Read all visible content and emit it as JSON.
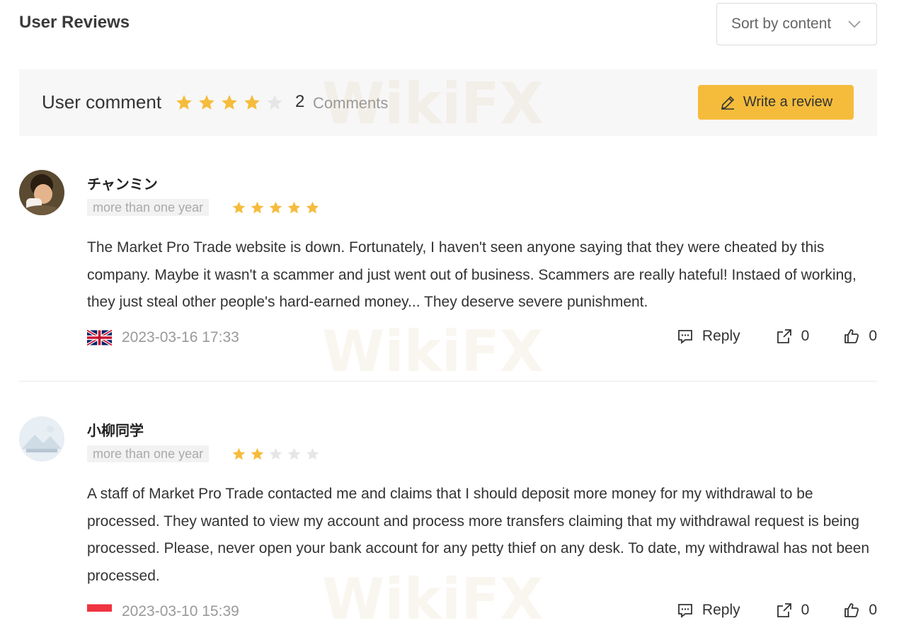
{
  "header": {
    "title": "User Reviews",
    "sort_label": "Sort by content"
  },
  "summary": {
    "label": "User comment",
    "rating": 4,
    "max_rating": 5,
    "count": "2",
    "count_label": "Comments",
    "write_button": "Write a review"
  },
  "reviews": [
    {
      "name": "チャンミン",
      "time_tag": "more than one year",
      "rating": 5,
      "text": "The Market Pro Trade website is down. Fortunately, I haven't seen anyone saying that they were cheated by this company. Maybe it wasn't a scammer and just went out of business. Scammers are really hateful! Instaed of working, they just steal other people's hard-earned money... They deserve severe punishment.",
      "flag": "uk-flag-icon",
      "date": "2023-03-16 17:33",
      "reply_label": "Reply",
      "share_count": "0",
      "like_count": "0"
    },
    {
      "name": "小柳同学",
      "time_tag": "more than one year",
      "rating": 2,
      "text": "A staff of Market Pro Trade contacted me and claims that I should deposit more money for my withdrawal to be processed. They wanted to view my account and process more transfers claiming that my withdrawal request is being processed. Please, never open your bank account for any petty thief on any desk. To date, my withdrawal has not been processed.",
      "flag": "singapore-flag-icon",
      "date": "2023-03-10 15:39",
      "reply_label": "Reply",
      "share_count": "0",
      "like_count": "0"
    }
  ],
  "watermark": "WikiFX",
  "colors": {
    "star_active": "#f5bc3c",
    "star_inactive": "#e6e6e6",
    "button": "#f5bc3c"
  }
}
